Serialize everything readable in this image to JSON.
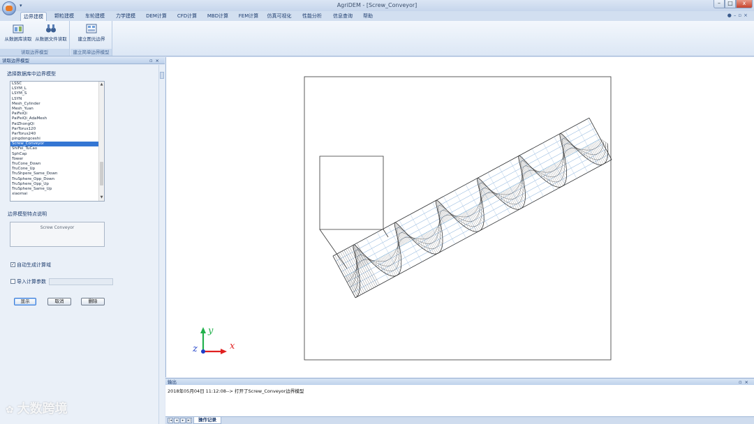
{
  "window": {
    "title": "AgriDEM - [Screw_Conveyor]",
    "controls": {
      "minimize": "–",
      "maximize": "□",
      "close": "x"
    }
  },
  "tabs": [
    "边界建模",
    "颗粒建模",
    "车轮建模",
    "力学建模",
    "DEM计算",
    "CFD计算",
    "MBD计算",
    "FEM计算",
    "仿真可视化",
    "性能分析",
    "信息查询",
    "帮助"
  ],
  "ribbon": {
    "group1": {
      "label": "读取边界模型",
      "btn_db": "从数据库读取",
      "btn_file": "从数据文件读取"
    },
    "group2": {
      "label": "建立简单边界模型",
      "btn_elem": "建立图元边界"
    }
  },
  "left_panel": {
    "title": "读取边界模型",
    "select_label": "选择数据库中边界模型",
    "models": [
      "LSSC",
      "LSYM_L",
      "LSYM_S",
      "LSYN",
      "Mesh_Cylinder",
      "Mesh_Yuan",
      "PaiFeiQi",
      "PaiFeiQi_AdaMesh",
      "PaiZhongQi",
      "ParTorus120",
      "ParTorus240",
      "pingdongceshi",
      "Screw_Conveyor",
      "ShiFei_TuCao",
      "SphCap",
      "Tower",
      "TruCone_Down",
      "TruCone_Up",
      "TruShpere_Same_Down",
      "TruSphere_Opp_Down",
      "TruSphere_Opp_Up",
      "TruSphere_Same_Up",
      "xiaomai"
    ],
    "selected_model": "Screw_Conveyor",
    "feature_label": "边界模型特点说明",
    "feature_text": "Screw Conveyor",
    "auto_domain_label": "自动生成计算域",
    "auto_domain_checked": true,
    "import_params_label": "导入计算参数",
    "import_params_checked": false,
    "buttons": {
      "show": "显示",
      "cancel": "取消",
      "delete": "删除"
    }
  },
  "viewport": {
    "axis_x": "x",
    "axis_y": "y",
    "axis_z": "z",
    "axis_colors": {
      "x": "#e02020",
      "y": "#22b14c",
      "z": "#1e3fc8"
    }
  },
  "output": {
    "title": "输出",
    "log": "2018年05月04日  11:12:08--> 打开了Screw_Conveyor边界模型",
    "tab_label": "操作记录"
  },
  "watermark": "大数跨境"
}
